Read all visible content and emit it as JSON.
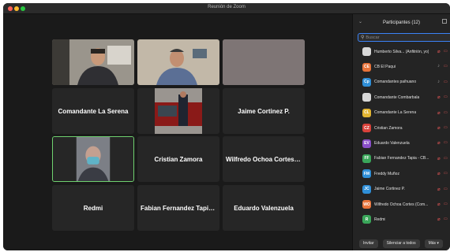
{
  "window": {
    "title": "Reunión de Zoom"
  },
  "gallery": {
    "tiles": [
      {
        "name": "",
        "type": "video"
      },
      {
        "name": "",
        "type": "video"
      },
      {
        "name": "",
        "type": "video"
      },
      {
        "name": "Comandante La Serena",
        "type": "name"
      },
      {
        "name": "",
        "type": "video"
      },
      {
        "name": "Jaime Cortinez P.",
        "type": "name"
      },
      {
        "name": "",
        "type": "video"
      },
      {
        "name": "Cristian Zamora",
        "type": "name"
      },
      {
        "name": "Wilfredo Ochoa Cortes (...",
        "type": "name"
      },
      {
        "name": "Redmi",
        "type": "name"
      },
      {
        "name": "Fabian Fernandez Tapia...",
        "type": "name"
      },
      {
        "name": "Eduardo Valenzuela",
        "type": "name"
      }
    ]
  },
  "panel": {
    "title": "Participantes (12)",
    "search_placeholder": "Buscar",
    "participants": [
      {
        "initials": "",
        "name": "Humberto Silva... (Anfitrión, yo)",
        "color": "photo",
        "mic": "muted"
      },
      {
        "initials": "CE",
        "name": "CB El Paqui",
        "color": "#e8733a",
        "mic": "on"
      },
      {
        "initials": "Cp",
        "name": "Comandantes paihuano",
        "color": "#2f8fd8",
        "mic": "on"
      },
      {
        "initials": "",
        "name": "Comandante Combarbala",
        "color": "photo",
        "mic": "muted"
      },
      {
        "initials": "CL",
        "name": "Comandante La Serena",
        "color": "#e2b533",
        "mic": "muted"
      },
      {
        "initials": "CZ",
        "name": "Cristian Zamora",
        "color": "#d9423b",
        "mic": "muted"
      },
      {
        "initials": "EV",
        "name": "Eduardo Valenzuela",
        "color": "#8a4fc9",
        "mic": "muted"
      },
      {
        "initials": "FF",
        "name": "Fabian Fernandez Tapia - CB...",
        "color": "#3aa65a",
        "mic": "muted"
      },
      {
        "initials": "FM",
        "name": "Freddy Muñoz",
        "color": "#2f8fd8",
        "mic": "muted"
      },
      {
        "initials": "JC",
        "name": "Jaime Cortinez P.",
        "color": "#2f8fd8",
        "mic": "muted"
      },
      {
        "initials": "WO",
        "name": "Wilfredo Ochoa Cortes (Com...",
        "color": "#e8733a",
        "mic": "muted"
      },
      {
        "initials": "R",
        "name": "Redmi",
        "color": "#3aa65a",
        "mic": "muted"
      }
    ],
    "footer": {
      "invite": "Invitar",
      "mute_all": "Silenciar a todos",
      "more": "Más ▾"
    }
  }
}
